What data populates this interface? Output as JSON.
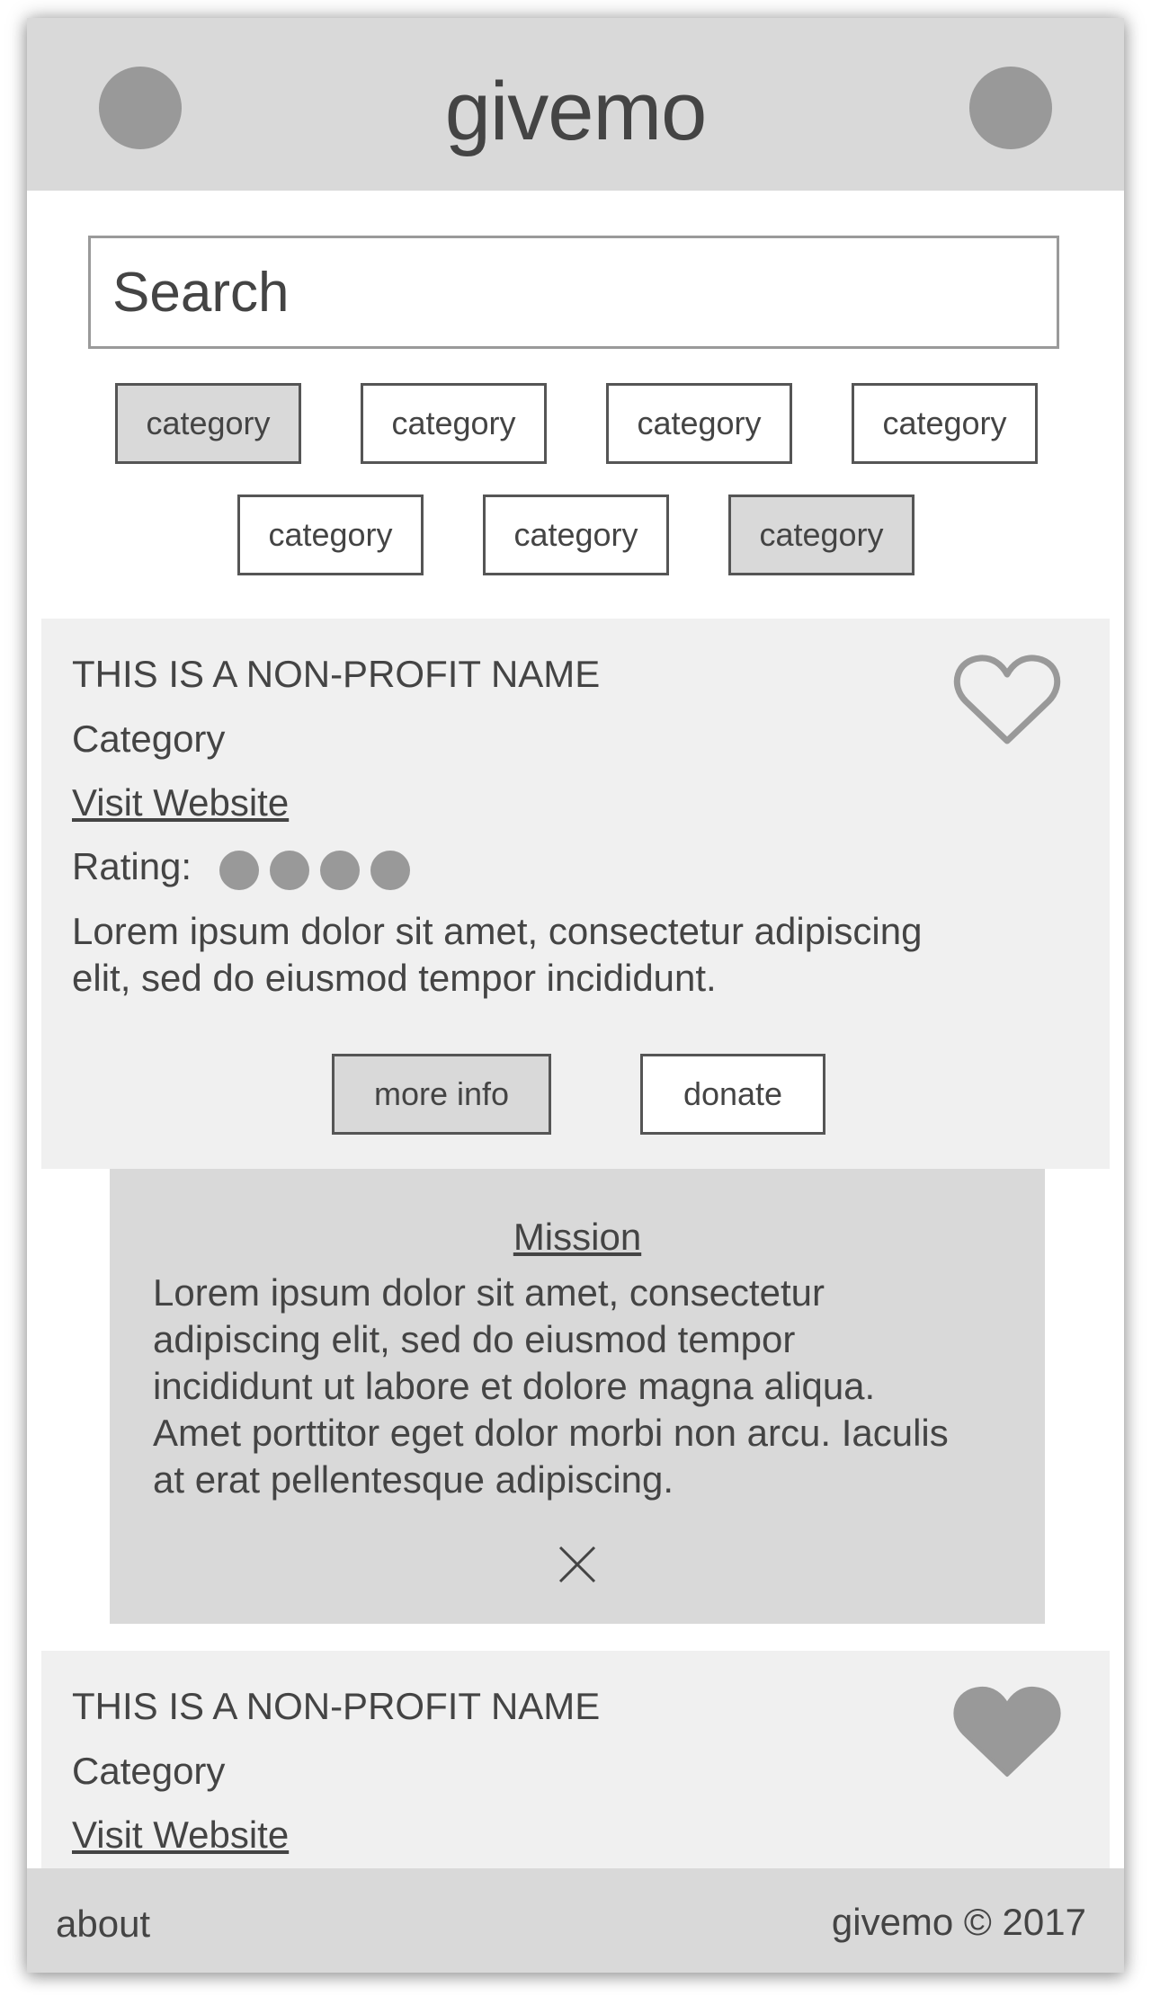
{
  "header": {
    "brand": "givemo",
    "left_button_icon": "circle-icon",
    "right_button_icon": "circle-icon"
  },
  "search": {
    "placeholder": "Search",
    "value": ""
  },
  "categories": [
    {
      "label": "category",
      "selected": true
    },
    {
      "label": "category",
      "selected": false
    },
    {
      "label": "category",
      "selected": false
    },
    {
      "label": "category",
      "selected": false
    },
    {
      "label": "category",
      "selected": false
    },
    {
      "label": "category",
      "selected": false
    },
    {
      "label": "category",
      "selected": true
    }
  ],
  "cards": [
    {
      "name": "THIS IS A NON-PROFIT NAME",
      "category": "Category",
      "link": "Visit Website",
      "rating_label": "Rating:",
      "rating_value": 4,
      "description_lines": [
        "Lorem ipsum dolor sit amet, consectetur adipiscing",
        "elit, sed do eiusmod tempor incididunt."
      ],
      "favorite": false,
      "heart_icon": "heart-outline-icon",
      "more_info_label": "more info",
      "donate_label": "donate"
    },
    {
      "name": "THIS IS A NON-PROFIT NAME",
      "category": "Category",
      "link": "Visit Website",
      "favorite": true,
      "heart_icon": "heart-filled-icon"
    }
  ],
  "mission": {
    "title": "Mission",
    "lines": [
      "Lorem ipsum dolor sit amet, consectetur",
      "adipiscing elit, sed do eiusmod tempor",
      "incididunt ut labore et dolore magna aliqua.",
      "Amet porttitor eget dolor morbi non arcu. Iaculis",
      "at erat pellentesque adipiscing."
    ],
    "close_icon": "close-icon"
  },
  "footer": {
    "about": "about",
    "copyright": "givemo © 2017"
  },
  "colors": {
    "header_bg": "#d9d9d9",
    "card_bg": "#f0f0f0",
    "mission_bg": "#d9d9d9",
    "placeholder_gray": "#999999",
    "text": "#444444"
  }
}
